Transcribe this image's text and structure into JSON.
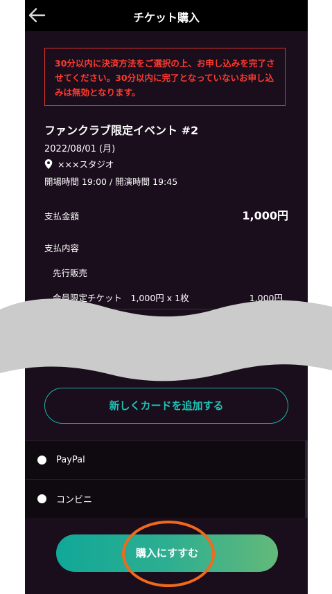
{
  "header": {
    "title": "チケット購入",
    "back_icon": "arrow-left-icon"
  },
  "warning": {
    "text": "30分以内に決済方法をご選択の上、お申し込みを完了させてください。30分以内に完了となっていないお申し込みは無効となります。",
    "color": "#ff3b30"
  },
  "event": {
    "title": "ファンクラブ限定イベント #2",
    "date": "2022/08/01 (月)",
    "venue": "×××スタジオ",
    "venue_icon": "location-pin-icon",
    "times": "開場時間 19:00 / 開演時間 19:45"
  },
  "payment": {
    "amount_label": "支払金額",
    "amount": "1,000円",
    "detail_label": "支払内容",
    "sale_type": "先行販売",
    "ticket_line": "会員限定チケット　1,000円 x 1枚",
    "ticket_price": "1,000円"
  },
  "card": {
    "add_label": "新しくカードを追加する"
  },
  "methods": [
    {
      "label": "PayPal"
    },
    {
      "label": "コンビニ"
    }
  ],
  "purchase": {
    "label": "購入にすすむ"
  },
  "colors": {
    "accent": "#1fc2b5",
    "highlight": "#f2691b",
    "background": "#1a0d1c"
  }
}
